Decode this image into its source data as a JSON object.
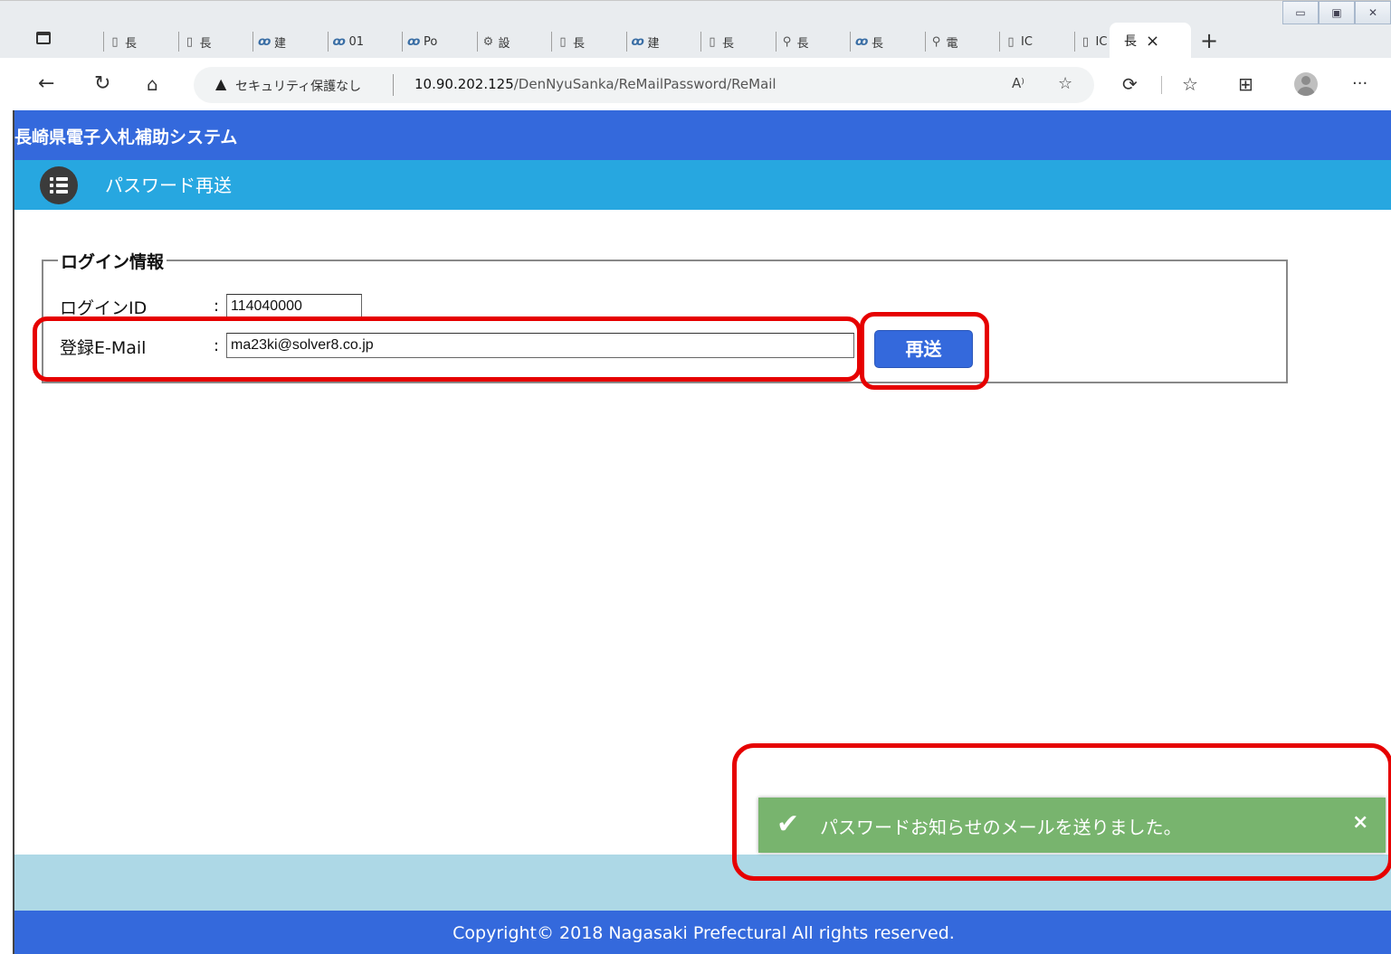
{
  "browser": {
    "tabs": [
      {
        "icon": "page",
        "label": "長"
      },
      {
        "icon": "page",
        "label": "長"
      },
      {
        "icon": "logo",
        "label": "建"
      },
      {
        "icon": "logo",
        "label": "01"
      },
      {
        "icon": "logo",
        "label": "Po"
      },
      {
        "icon": "gear",
        "label": "設"
      },
      {
        "icon": "page",
        "label": "長"
      },
      {
        "icon": "logo",
        "label": "建"
      },
      {
        "icon": "page",
        "label": "長"
      },
      {
        "icon": "search",
        "label": "長"
      },
      {
        "icon": "logo",
        "label": "長"
      },
      {
        "icon": "search",
        "label": "電"
      },
      {
        "icon": "page",
        "label": "IC"
      },
      {
        "icon": "page",
        "label": "IC"
      }
    ],
    "active_tab": {
      "label": "長",
      "close": "×"
    },
    "new_tab": "+",
    "security_warning": "セキュリティ保護なし",
    "url_host": "10.90.202.125",
    "url_path": "/DenNyuSanka/ReMailPassword/ReMail"
  },
  "app": {
    "system_title": "長崎県電子入札補助システム",
    "page_title": "パスワード再送"
  },
  "form": {
    "legend": "ログイン情報",
    "login_id_label": "ログインID",
    "login_id_value": "114040000",
    "email_label": "登録E-Mail",
    "email_value": "ma23ki@solver8.co.jp",
    "colon": ":",
    "resend_button": "再送"
  },
  "toast": {
    "message": "パスワードお知らせのメールを送りました。",
    "close": "×"
  },
  "footer": {
    "copyright": "Copyright© 2018 Nagasaki Prefectural All rights reserved."
  },
  "colors": {
    "header_blue": "#3469dc",
    "subheader_blue": "#27a7e0",
    "toast_green": "#78b46e",
    "highlight_red": "#e60000"
  }
}
